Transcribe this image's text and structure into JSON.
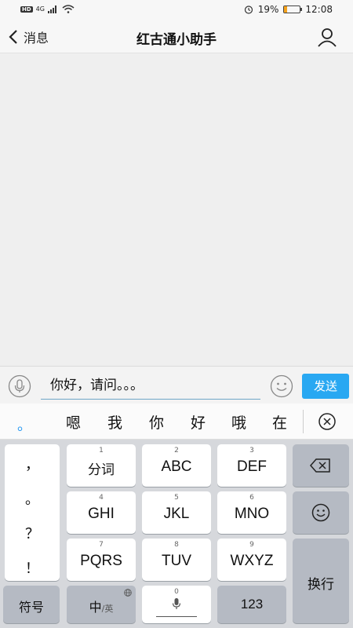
{
  "status_bar": {
    "hd": "HD",
    "network": "4G",
    "battery_percent": "19%",
    "battery_level": 0.19,
    "time": "12:08"
  },
  "header": {
    "back_label": "消息",
    "title": "红古通小助手",
    "user_icon": "user-icon"
  },
  "input_bar": {
    "value": "你好，请问。。。",
    "send_label": "发送",
    "mic_icon": "microphone-icon",
    "emoji_icon": "emoji-icon"
  },
  "candidates": {
    "first": "。",
    "items": [
      "嗯",
      "我",
      "你",
      "好",
      "哦",
      "在"
    ],
    "close_icon": "close-circle-icon"
  },
  "keyboard": {
    "punctuation": [
      "，",
      "。",
      "？",
      "！"
    ],
    "keys": [
      {
        "num": "1",
        "label": "分词"
      },
      {
        "num": "2",
        "label": "ABC"
      },
      {
        "num": "3",
        "label": "DEF"
      },
      {
        "num": "4",
        "label": "GHI"
      },
      {
        "num": "5",
        "label": "JKL"
      },
      {
        "num": "6",
        "label": "MNO"
      },
      {
        "num": "7",
        "label": "PQRS"
      },
      {
        "num": "8",
        "label": "TUV"
      },
      {
        "num": "9",
        "label": "WXYZ"
      }
    ],
    "backspace_icon": "backspace-icon",
    "emoji_icon": "emoji-icon",
    "enter_label": "换行",
    "symbols_label": "符号",
    "lang_label": "中",
    "lang_sub": "/英",
    "space_num": "0",
    "numbers_label": "123"
  }
}
